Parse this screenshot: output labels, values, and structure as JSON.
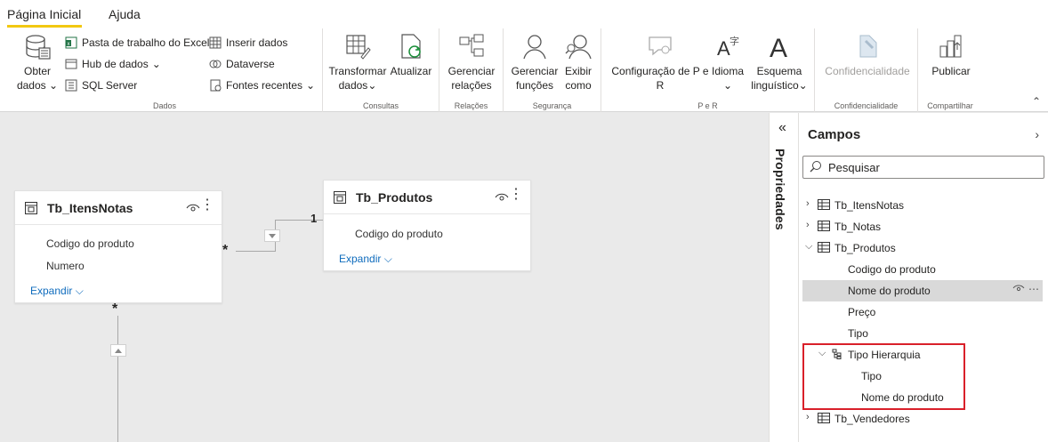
{
  "tabs": [
    {
      "label": "Página Inicial",
      "active": true
    },
    {
      "label": "Ajuda",
      "active": false
    }
  ],
  "ribbon": {
    "dados": {
      "obter_dados": "Obter",
      "obter_dados2": "dados",
      "excel": "Pasta de trabalho do Excel",
      "hub": "Hub de dados",
      "sql": "SQL Server",
      "inserir": "Inserir dados",
      "dataverse": "Dataverse",
      "fontes": "Fontes recentes",
      "group": "Dados"
    },
    "consultas": {
      "transformar": "Transformar",
      "transformar2": "dados",
      "atualizar": "Atualizar",
      "group": "Consultas"
    },
    "relacoes": {
      "gerenciar": "Gerenciar",
      "gerenciar2": "relações",
      "group": "Relações"
    },
    "seguranca": {
      "funcoes": "Gerenciar",
      "funcoes2": "funções",
      "exibir": "Exibir",
      "exibir2": "como",
      "group": "Segurança"
    },
    "per": {
      "config": "Configuração de P e",
      "config2": "R",
      "idioma": "Idioma",
      "esquema": "Esquema",
      "esquema2": "linguístico",
      "group": "P e R"
    },
    "confid": {
      "label": "Confidencialidade",
      "group": "Confidencialidade"
    },
    "compartilhar": {
      "publicar": "Publicar",
      "group": "Compartilhar"
    }
  },
  "canvas": {
    "itens": {
      "title": "Tb_ItensNotas",
      "fields": [
        "Codigo do produto",
        "Numero"
      ],
      "expand": "Expandir"
    },
    "produtos": {
      "title": "Tb_Produtos",
      "fields": [
        "Codigo do produto"
      ],
      "expand": "Expandir"
    },
    "rel_many": "*",
    "rel_one": "1",
    "rel_many_bottom": "*"
  },
  "properties": {
    "label": "Propriedades"
  },
  "fields_pane": {
    "title": "Campos",
    "search_placeholder": "Pesquisar",
    "tables": {
      "itens": "Tb_ItensNotas",
      "notas": "Tb_Notas",
      "produtos": "Tb_Produtos",
      "vendedores": "Tb_Vendedores"
    },
    "produtos_fields": {
      "codigo": "Codigo do produto",
      "nome": "Nome do produto",
      "preco": "Preço",
      "tipo": "Tipo"
    },
    "hierarchy": {
      "name": "Tipo Hierarquia",
      "levels": [
        "Tipo",
        "Nome do produto"
      ]
    },
    "row_tools": "⋯"
  },
  "colors": {
    "accent": "#f2c811",
    "link": "#0f6cbd",
    "highlight": "#d9202a"
  }
}
